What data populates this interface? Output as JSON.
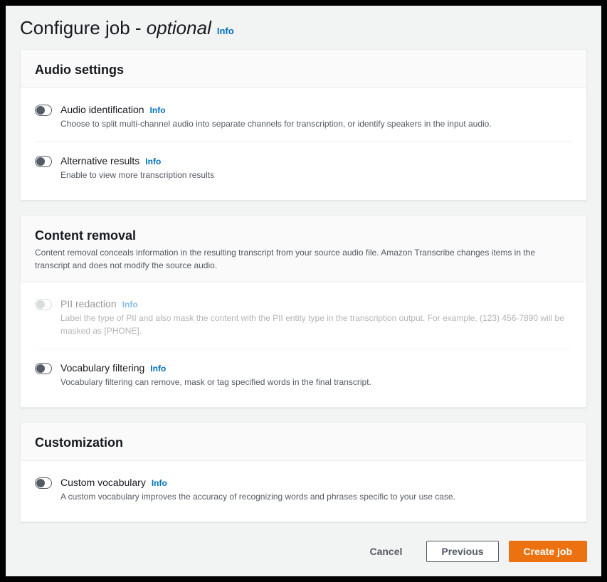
{
  "header": {
    "title_prefix": "Configure job - ",
    "title_emph": "optional",
    "info": "Info"
  },
  "info_label": "Info",
  "panels": {
    "audio": {
      "title": "Audio settings",
      "items": {
        "audio_identification": {
          "title": "Audio identification",
          "desc": "Choose to split multi-channel audio into separate channels for transcription, or identify speakers in the input audio."
        },
        "alternative_results": {
          "title": "Alternative results",
          "desc": "Enable to view more transcription results"
        }
      }
    },
    "content_removal": {
      "title": "Content removal",
      "desc": "Content removal conceals information in the resulting transcript from your source audio file. Amazon Transcribe changes items in the transcript and does not modify the source audio.",
      "items": {
        "pii_redaction": {
          "title": "PII redaction",
          "desc": "Label the type of PII and also mask the content with the PII entity type in the transcription output. For example, (123) 456-7890 will be masked as [PHONE]."
        },
        "vocabulary_filtering": {
          "title": "Vocabulary filtering",
          "desc": "Vocabulary filtering can remove, mask or tag specified words in the final transcript."
        }
      }
    },
    "customization": {
      "title": "Customization",
      "items": {
        "custom_vocabulary": {
          "title": "Custom vocabulary",
          "desc": "A custom vocabulary improves the accuracy of recognizing words and phrases specific to your use case."
        }
      }
    }
  },
  "footer": {
    "cancel": "Cancel",
    "previous": "Previous",
    "create": "Create job"
  }
}
